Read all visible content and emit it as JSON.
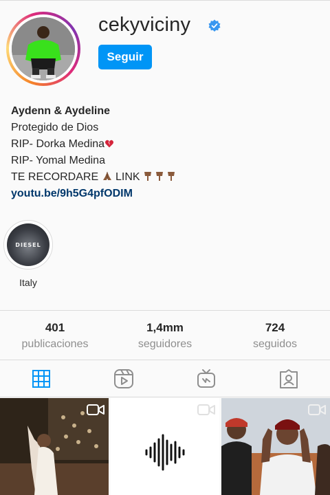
{
  "profile": {
    "username": "cekyviciny",
    "follow_label": "Seguir",
    "display_name": "Aydenn & Aydeline",
    "bio_lines": [
      "Protegido de Dios",
      "RIP- Dorka Medina",
      "RIP- Yomal Medina",
      "TE RECORDARE",
      "LINK"
    ],
    "link": "youtu.be/9h5G4pfODIM"
  },
  "highlights": [
    {
      "label": "Italy",
      "cover_text": "DIESEL"
    }
  ],
  "stats": {
    "posts": {
      "value": "401",
      "label": "publicaciones"
    },
    "followers": {
      "value": "1,4mm",
      "label": "seguidores"
    },
    "following": {
      "value": "724",
      "label": "seguidos"
    }
  },
  "tabs": [
    {
      "name": "grid-icon",
      "active": true
    },
    {
      "name": "reels-icon",
      "active": false
    },
    {
      "name": "igtv-icon",
      "active": false
    },
    {
      "name": "tagged-icon",
      "active": false
    }
  ],
  "colors": {
    "accent": "#0095f6",
    "link": "#00376b",
    "muted": "#8e8e8e",
    "border": "#dbdbdb"
  }
}
